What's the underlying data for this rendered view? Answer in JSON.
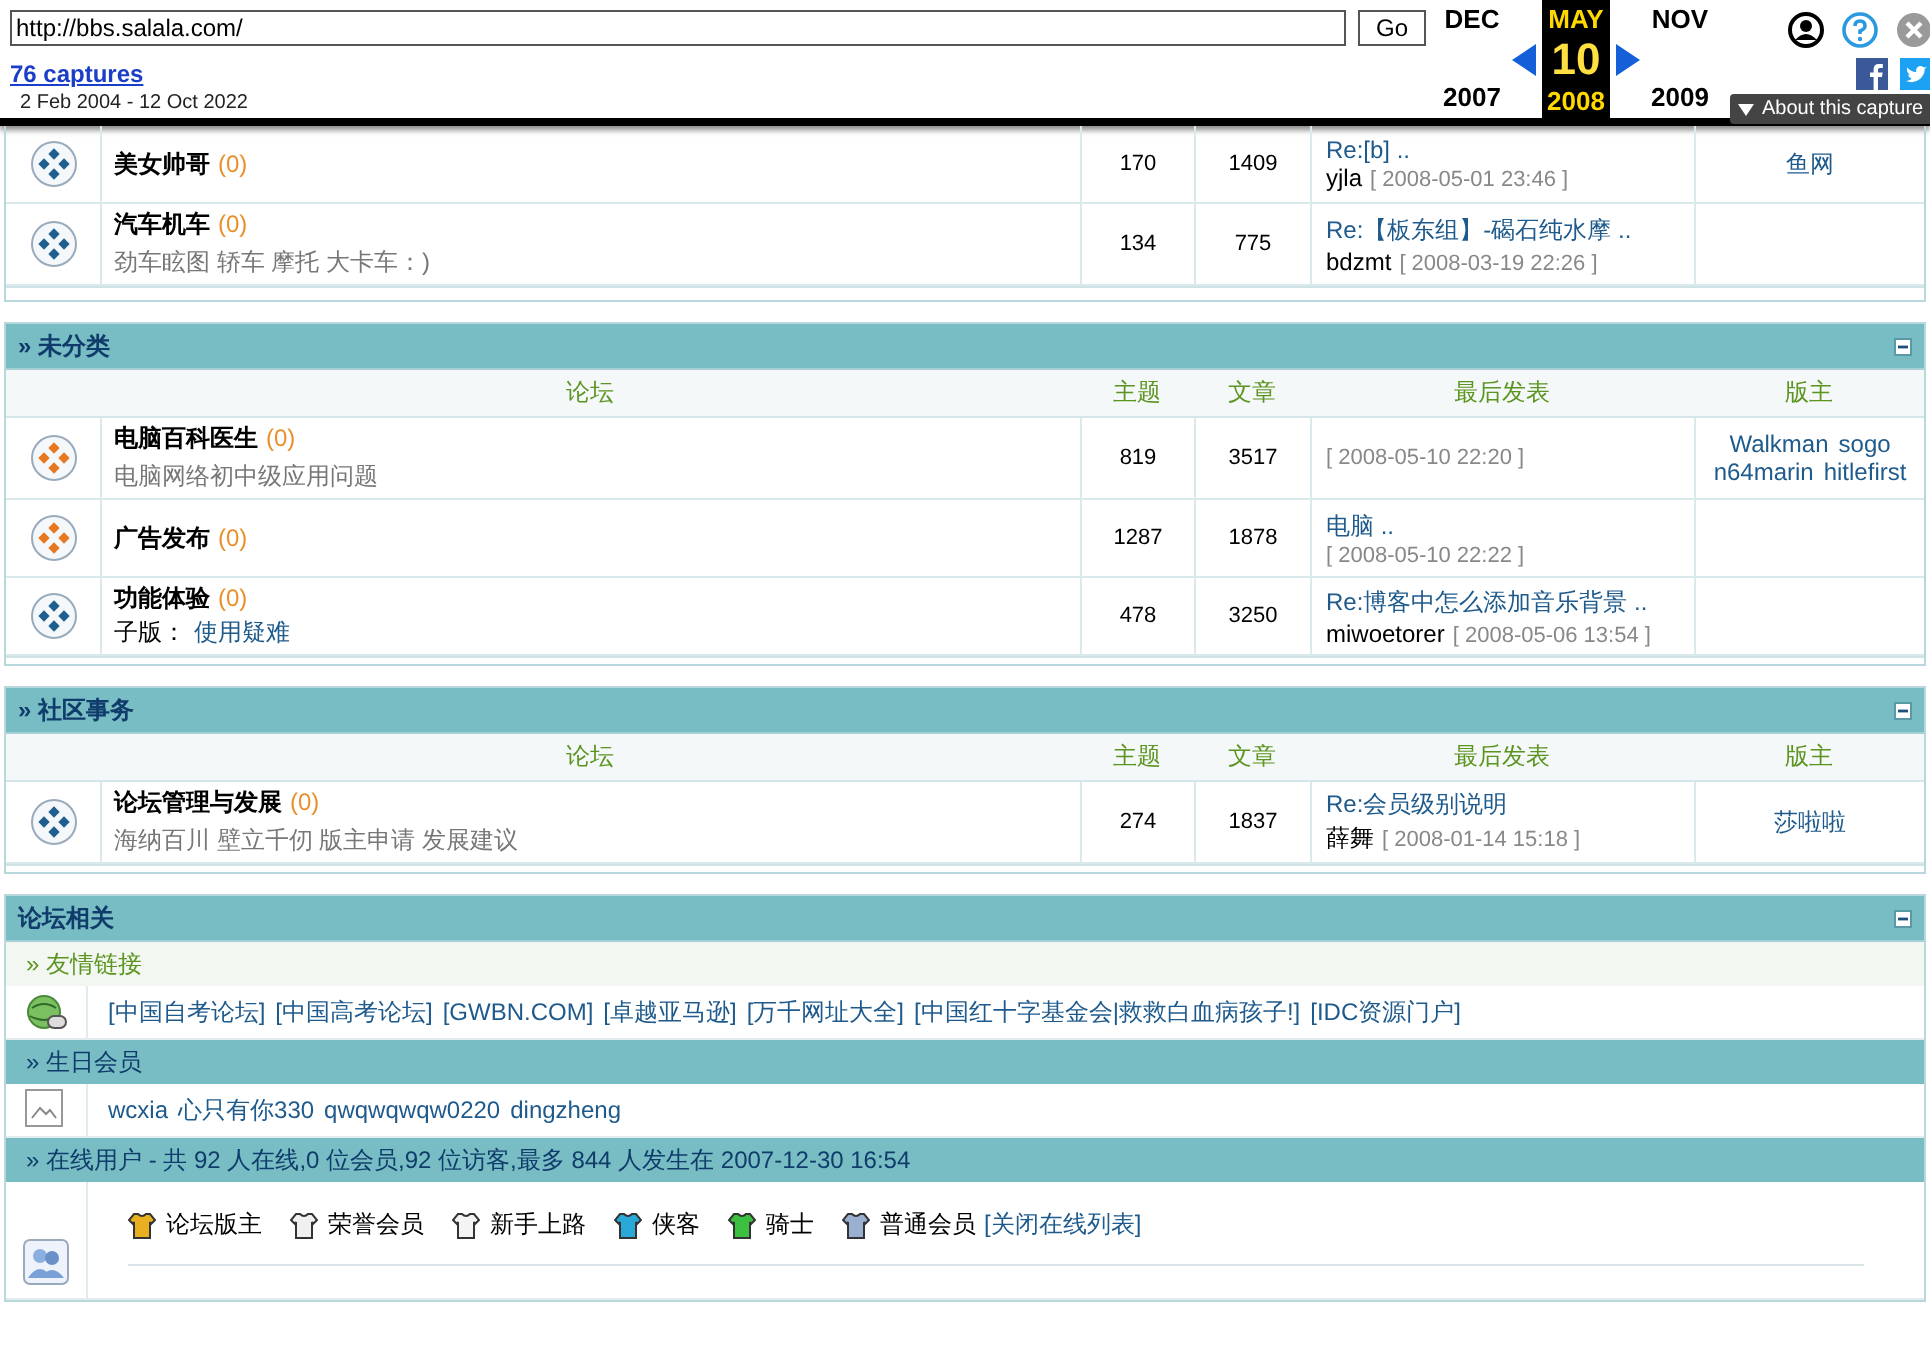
{
  "wayback": {
    "url": "http://bbs.salala.com/",
    "go": "Go",
    "captures": "76 captures",
    "range": "2 Feb 2004 - 12 Oct 2022",
    "months": [
      {
        "month": "DEC",
        "year": "2007",
        "selected": false
      },
      {
        "month": "MAY",
        "day": "10",
        "year": "2008",
        "selected": true
      },
      {
        "month": "NOV",
        "year": "2009",
        "selected": false
      }
    ],
    "about": "About this capture"
  },
  "sections": [
    {
      "forums": [
        {
          "name": "美女帅哥",
          "today": "(0)",
          "new": false,
          "topics": "170",
          "posts": "1409",
          "last_post": {
            "title": "Re:[b] ..",
            "author": "yjla",
            "date": "[ 2008-05-01 23:46 ]"
          },
          "moderators": [
            "鱼网"
          ]
        },
        {
          "name": "汽车机车",
          "today": "(0)",
          "new": false,
          "description": "劲车眩图 轿车 摩托 大卡车：)",
          "topics": "134",
          "posts": "775",
          "last_post": {
            "title": "Re:【板东组】-碣石纯水摩 ..",
            "author": "bdzmt",
            "date": "[ 2008-03-19 22:26 ]"
          }
        }
      ]
    },
    {
      "title": "» 未分类",
      "columns": [
        "论坛",
        "主题",
        "文章",
        "最后发表",
        "版主"
      ],
      "forums": [
        {
          "name": "电脑百科医生",
          "today": "(0)",
          "new": true,
          "description": "电脑网络初中级应用问题",
          "topics": "819",
          "posts": "3517",
          "last_post": {
            "date": "[ 2008-05-10 22:20 ]"
          },
          "moderators": [
            "Walkman",
            "sogo",
            "n64marin",
            "hitlefirst"
          ]
        },
        {
          "name": "广告发布",
          "today": "(0)",
          "new": true,
          "topics": "1287",
          "posts": "1878",
          "last_post": {
            "title": "电脑 ..",
            "date": "[ 2008-05-10 22:22 ]"
          }
        },
        {
          "name": "功能体验",
          "today": "(0)",
          "new": false,
          "subforums": {
            "label": "子版：",
            "items": [
              "使用疑难"
            ]
          },
          "topics": "478",
          "posts": "3250",
          "last_post": {
            "title": "Re:博客中怎么添加音乐背景 ..",
            "author": "miwoetorer",
            "date": "[ 2008-05-06 13:54 ]"
          }
        }
      ]
    },
    {
      "title": "» 社区事务",
      "columns": [
        "论坛",
        "主题",
        "文章",
        "最后发表",
        "版主"
      ],
      "forums": [
        {
          "name": "论坛管理与发展",
          "today": "(0)",
          "new": false,
          "description": "海纳百川 壁立千仞 版主申请 发展建议",
          "topics": "274",
          "posts": "1837",
          "last_post": {
            "title": "Re:会员级别说明",
            "author": "薛舞",
            "date": "[ 2008-01-14 15:18 ]"
          },
          "moderators": [
            "莎啦啦"
          ]
        }
      ]
    }
  ],
  "related": {
    "title": "论坛相关",
    "links": {
      "title": "» 友情链接",
      "items": [
        "[中国自考论坛]",
        "[中国高考论坛]",
        "[GWBN.COM]",
        "[卓越亚马逊]",
        "[万千网址大全]",
        "[中国红十字基金会|救救白血病孩子!]",
        "[IDC资源门户]"
      ]
    },
    "birthdays": {
      "title": "» 生日会员",
      "items": [
        "wcxia",
        "心只有你330",
        "qwqwqwqw0220",
        "dingzheng"
      ]
    },
    "online": {
      "title": "» 在线用户 - 共 92 人在线,0 位会员,92 位访客,最多 844 人发生在 2007-12-30 16:54",
      "legend": [
        {
          "label": "论坛版主",
          "color": "#e8b020"
        },
        {
          "label": "荣誉会员",
          "color": "#f0f0f0"
        },
        {
          "label": "新手上路",
          "color": "#f4f4f4"
        },
        {
          "label": "侠客",
          "color": "#2aa8d8"
        },
        {
          "label": "骑士",
          "color": "#3cc040"
        },
        {
          "label": "普通会员",
          "color": "#9ab0d0"
        }
      ],
      "close": "[关闭在线列表]"
    }
  }
}
